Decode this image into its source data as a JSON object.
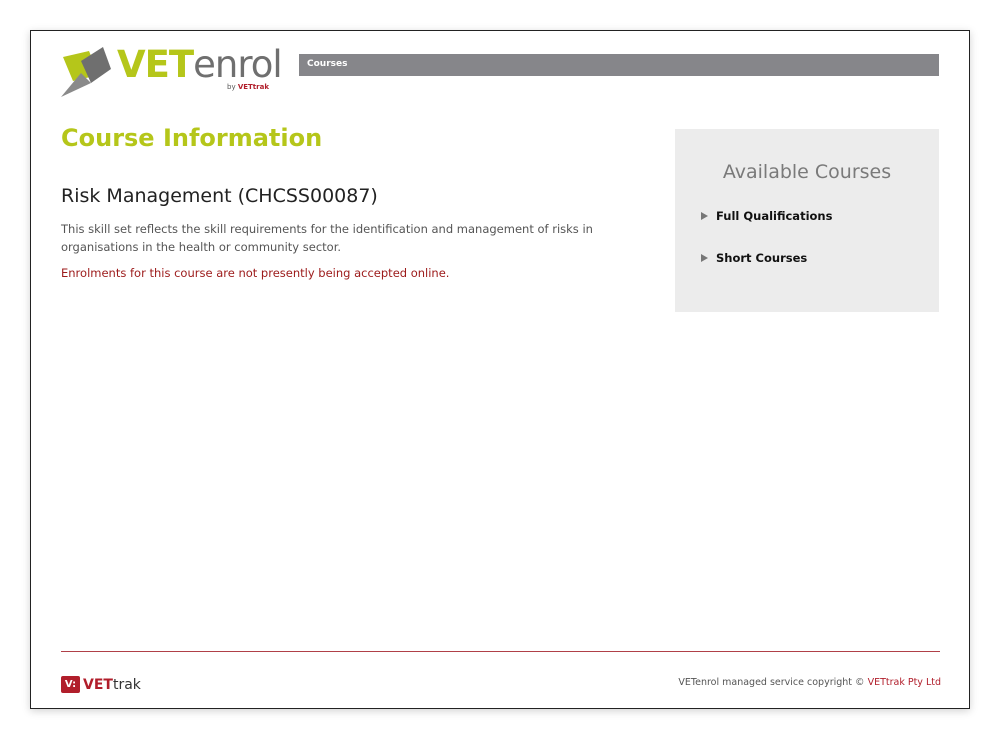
{
  "header": {
    "logo": {
      "brand_bold": "VET",
      "brand_light": "enrol",
      "by_text": "by",
      "by_brand": "VETtrak",
      "mark_colors": [
        "#b5c61a",
        "#6f6f6f"
      ]
    },
    "nav": {
      "items": [
        {
          "label": "Courses"
        }
      ]
    }
  },
  "main": {
    "page_title": "Course Information",
    "course": {
      "title": "Risk Management (CHCSS00087)",
      "description": "This skill set reflects the skill requirements for the identification and management of risks in organisations in the health or community sector.",
      "notice": "Enrolments for this course are not presently being accepted online."
    }
  },
  "sidebar": {
    "title": "Available Courses",
    "links": [
      {
        "label": "Full Qualifications",
        "icon": "triangle-right-icon"
      },
      {
        "label": "Short Courses",
        "icon": "triangle-right-icon"
      }
    ]
  },
  "footer": {
    "logo": {
      "mark": "V:",
      "brand_bold": "VET",
      "brand_light": "trak"
    },
    "copyright_text": "VETenrol managed service copyright © ",
    "copyright_link": "VETtrak Pty Ltd"
  },
  "colors": {
    "accent_green": "#b5c61a",
    "brand_red": "#b11e2b",
    "nav_gray": "#86868a",
    "panel_gray": "#ececec",
    "notice_red": "#9c1a1a"
  }
}
